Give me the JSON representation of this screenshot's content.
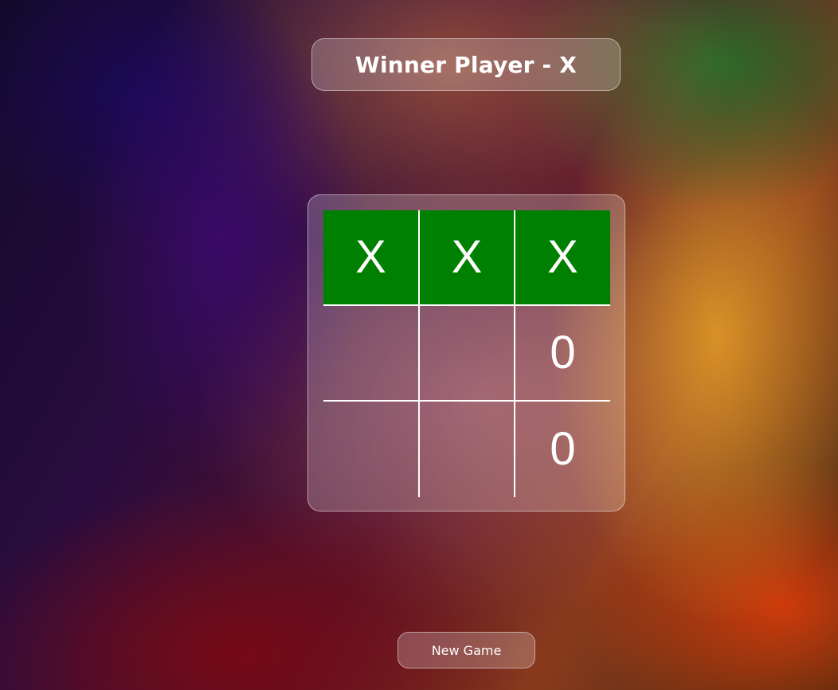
{
  "header": {
    "winner_text": "Winner Player - X"
  },
  "board": {
    "cells": [
      "X",
      "X",
      "X",
      "",
      "",
      "0",
      "",
      "",
      "0"
    ],
    "winning_row": [
      0,
      1,
      2
    ],
    "win_color": "#008000"
  },
  "controls": {
    "new_game_label": "New Game"
  }
}
